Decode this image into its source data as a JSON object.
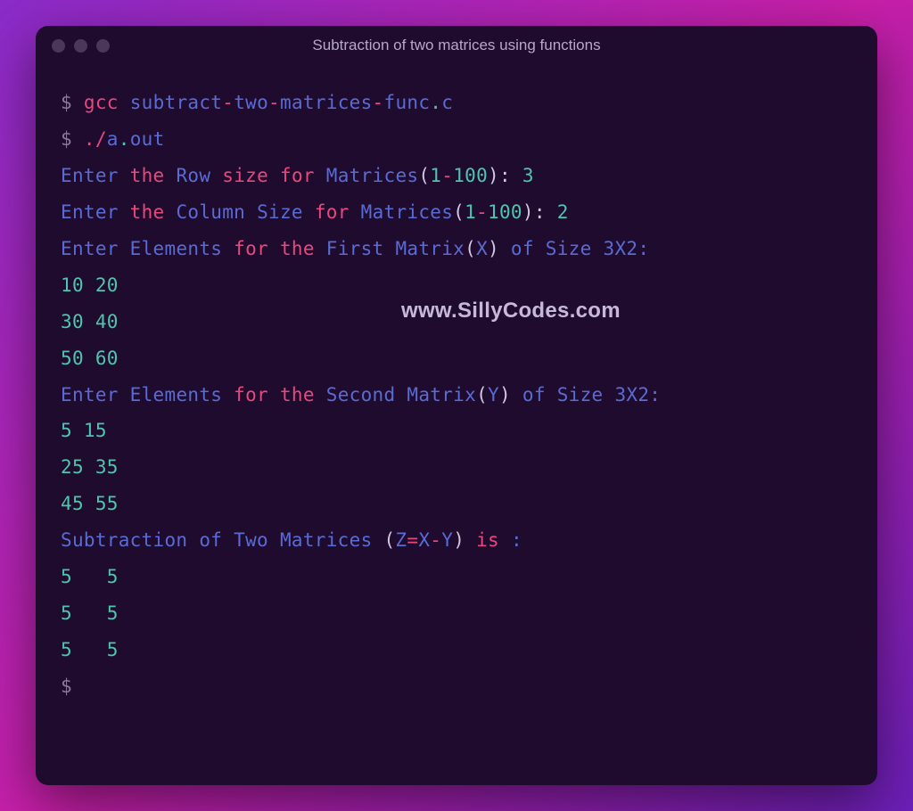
{
  "window": {
    "title": "Subtraction of two matrices using functions"
  },
  "watermark": "www.SillyCodes.com",
  "terminal": {
    "prompt_symbol": "$",
    "line1": {
      "cmd": "gcc",
      "args": [
        "subtract",
        "-",
        "two",
        "-",
        "matrices",
        "-",
        "func",
        ".",
        "c"
      ]
    },
    "line2": {
      "dot_slash": "./",
      "a": "a",
      "dot": ".",
      "out": "out"
    },
    "line3": {
      "enter": "Enter",
      "the": "the",
      "row": "Row",
      "size": "size",
      "for_": "for",
      "matrices": "Matrices",
      "lparen": "(",
      "one": "1",
      "dash": "-",
      "hundred": "100",
      "rparen_colon": "):",
      "input": "3"
    },
    "line4": {
      "enter": "Enter",
      "the": "the",
      "column": "Column",
      "cap_size": "Size",
      "for_": "for",
      "matrices": "Matrices",
      "lparen": "(",
      "one": "1",
      "dash": "-",
      "hundred": "100",
      "rparen_colon": "):",
      "input": "2"
    },
    "line5": {
      "enter": "Enter",
      "elements": "Elements",
      "for_": "for",
      "the": "the",
      "first": "First",
      "matrix": "Matrix",
      "lparen": "(",
      "x": "X",
      "rparen": ")",
      "of": "of",
      "cap_size": "Size",
      "size_val": "3X2:"
    },
    "matrix_x": {
      "r1c1": "10",
      "r1c2": "20",
      "r2c1": "30",
      "r2c2": "40",
      "r3c1": "50",
      "r3c2": "60"
    },
    "line9": {
      "enter": "Enter",
      "elements": "Elements",
      "for_": "for",
      "the": "the",
      "second": "Second",
      "matrix": "Matrix",
      "lparen": "(",
      "y": "Y",
      "rparen": ")",
      "of": "of",
      "cap_size": "Size",
      "size_val": "3X2:"
    },
    "matrix_y": {
      "r1c1": "5",
      "r1c2": "15",
      "r2c1": "25",
      "r2c2": "35",
      "r3c1": "45",
      "r3c2": "55"
    },
    "line13": {
      "subtraction": "Subtraction",
      "of": "of",
      "two": "Two",
      "matrices": "Matrices",
      "lparen": "(",
      "z": "Z",
      "eq": "=",
      "x": "X",
      "minus": "-",
      "y": "Y",
      "rparen": ")",
      "is": "is",
      "colon": ":"
    },
    "matrix_z": {
      "r1c1": "5",
      "r1c2": "5",
      "r2c1": "5",
      "r2c2": "5",
      "r3c1": "5",
      "r3c2": "5"
    }
  }
}
